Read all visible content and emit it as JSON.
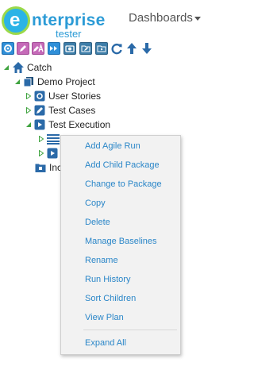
{
  "header": {
    "logo": {
      "main": "nterprise",
      "sub": "tester",
      "letter": "e"
    },
    "dashboards_label": "Dashboards"
  },
  "toolbar": {
    "buttons": [
      {
        "icon": "settings-icon",
        "color": "#2f8fd8"
      },
      {
        "icon": "pencil-icon",
        "color": "#c56ab8"
      },
      {
        "icon": "edit-text-icon",
        "color": "#c56ab8"
      },
      {
        "icon": "fast-forward-icon",
        "color": "#2f8fd8"
      },
      {
        "icon": "record-icon",
        "color": "#3e7ea9"
      },
      {
        "icon": "folder-pencil-icon",
        "color": "#3e7ea9"
      },
      {
        "icon": "folder-play-icon",
        "color": "#3e7ea9"
      },
      {
        "icon": "refresh-icon",
        "color": "#2b6aa8"
      },
      {
        "icon": "arrow-up-icon",
        "color": "#2b6aa8"
      },
      {
        "icon": "arrow-down-icon",
        "color": "#2b6aa8"
      }
    ]
  },
  "tree": {
    "root": "Catch",
    "project": "Demo Project",
    "user_stories": "User Stories",
    "test_cases": "Test Cases",
    "test_execution": "Test Execution",
    "partial_label": "Inc"
  },
  "context_menu": {
    "items": [
      "Add Agile Run",
      "Add Child Package",
      "Change to Package",
      "Copy",
      "Delete",
      "Manage Baselines",
      "Rename",
      "Run History",
      "Sort Children",
      "View Plan"
    ],
    "footer_item": "Expand All"
  },
  "colors": {
    "link": "#2a86c8",
    "brand_blue": "#2bb3e6",
    "brand_green": "#9bd94a",
    "expander_green": "#3fa33f"
  }
}
